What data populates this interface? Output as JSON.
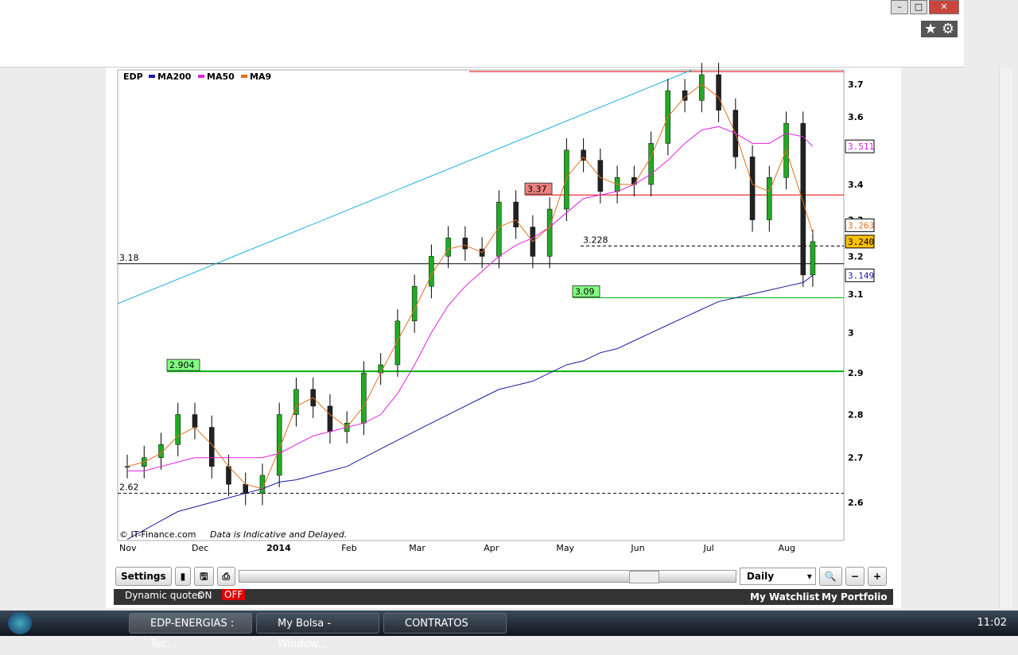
{
  "legend": {
    "symbol": "EDP",
    "items": [
      {
        "name": "MA200",
        "color": "#1a1aa0"
      },
      {
        "name": "MA50",
        "color": "#e020e0"
      },
      {
        "name": "MA9",
        "color": "#e07020"
      }
    ]
  },
  "copyright": "© IT-Finance.com",
  "disclaimer": "Data is Indicative and Delayed.",
  "chart_data": {
    "type": "candlestick",
    "yscale": "log",
    "ylim": [
      2.52,
      3.74
    ],
    "y_ticks": [
      3.7,
      3.6,
      3.4,
      3.3,
      3.2,
      3.1,
      3,
      2.9,
      2.8,
      2.7,
      2.6
    ],
    "x_ticks": [
      {
        "label": "Nov",
        "date": "2013-11-01"
      },
      {
        "label": "Dec",
        "date": "2013-12-01"
      },
      {
        "label": "2014",
        "date": "2014-01-01"
      },
      {
        "label": "Feb",
        "date": "2014-02-01"
      },
      {
        "label": "Mar",
        "date": "2014-03-01"
      },
      {
        "label": "Apr",
        "date": "2014-04-01"
      },
      {
        "label": "May",
        "date": "2014-05-01"
      },
      {
        "label": "Jun",
        "date": "2014-06-01"
      },
      {
        "label": "Jul",
        "date": "2014-07-01"
      },
      {
        "label": "Aug",
        "date": "2014-08-01"
      }
    ],
    "dates": [
      "2013-11-01",
      "2013-11-08",
      "2013-11-15",
      "2013-11-22",
      "2013-11-29",
      "2013-12-06",
      "2013-12-13",
      "2013-12-20",
      "2013-12-27",
      "2014-01-03",
      "2014-01-10",
      "2014-01-17",
      "2014-01-24",
      "2014-01-31",
      "2014-02-07",
      "2014-02-14",
      "2014-02-21",
      "2014-02-28",
      "2014-03-07",
      "2014-03-14",
      "2014-03-21",
      "2014-03-28",
      "2014-04-04",
      "2014-04-11",
      "2014-04-18",
      "2014-04-25",
      "2014-05-02",
      "2014-05-09",
      "2014-05-16",
      "2014-05-23",
      "2014-05-30",
      "2014-06-06",
      "2014-06-13",
      "2014-06-20",
      "2014-06-27",
      "2014-07-04",
      "2014-07-11",
      "2014-07-18",
      "2014-07-25",
      "2014-08-01",
      "2014-08-08",
      "2014-08-12"
    ],
    "close": [
      2.68,
      2.7,
      2.73,
      2.8,
      2.77,
      2.68,
      2.64,
      2.62,
      2.66,
      2.8,
      2.86,
      2.82,
      2.76,
      2.78,
      2.9,
      2.92,
      3.03,
      3.12,
      3.2,
      3.25,
      3.22,
      3.2,
      3.35,
      3.28,
      3.2,
      3.33,
      3.5,
      3.47,
      3.38,
      3.42,
      3.4,
      3.52,
      3.68,
      3.65,
      3.73,
      3.62,
      3.48,
      3.3,
      3.42,
      3.58,
      3.15,
      3.24
    ],
    "ma200": [
      2.52,
      2.54,
      2.56,
      2.58,
      2.59,
      2.6,
      2.61,
      2.62,
      2.63,
      2.645,
      2.65,
      2.66,
      2.67,
      2.68,
      2.7,
      2.72,
      2.74,
      2.76,
      2.78,
      2.8,
      2.82,
      2.84,
      2.86,
      2.87,
      2.88,
      2.9,
      2.92,
      2.93,
      2.95,
      2.96,
      2.98,
      3.0,
      3.02,
      3.04,
      3.06,
      3.08,
      3.09,
      3.1,
      3.11,
      3.12,
      3.13,
      3.149
    ],
    "ma50": [
      2.67,
      2.67,
      2.68,
      2.69,
      2.7,
      2.7,
      2.7,
      2.7,
      2.7,
      2.71,
      2.73,
      2.75,
      2.76,
      2.77,
      2.78,
      2.8,
      2.85,
      2.92,
      3.0,
      3.07,
      3.12,
      3.16,
      3.2,
      3.23,
      3.25,
      3.28,
      3.32,
      3.36,
      3.37,
      3.38,
      3.4,
      3.43,
      3.47,
      3.52,
      3.56,
      3.57,
      3.55,
      3.52,
      3.52,
      3.55,
      3.54,
      3.511
    ],
    "ma9": [
      2.68,
      2.69,
      2.71,
      2.75,
      2.77,
      2.73,
      2.68,
      2.64,
      2.63,
      2.72,
      2.82,
      2.84,
      2.8,
      2.77,
      2.82,
      2.9,
      2.98,
      3.06,
      3.15,
      3.22,
      3.23,
      3.21,
      3.28,
      3.3,
      3.24,
      3.28,
      3.42,
      3.48,
      3.42,
      3.4,
      3.4,
      3.48,
      3.6,
      3.66,
      3.7,
      3.66,
      3.55,
      3.4,
      3.38,
      3.5,
      3.35,
      3.263
    ],
    "levels": [
      {
        "value": 3.74,
        "color": "#e00000",
        "label": ""
      },
      {
        "value": 3.37,
        "color": "#e00000",
        "label": "3.37"
      },
      {
        "value": 3.228,
        "color": "#000000",
        "dashed": true,
        "label": "3.228"
      },
      {
        "value": 3.18,
        "color": "#000000",
        "label": "3.18"
      },
      {
        "value": 3.09,
        "color": "#00b000",
        "label": "3.09"
      },
      {
        "value": 2.904,
        "color": "#00b000",
        "label": "2.904"
      },
      {
        "value": 2.62,
        "color": "#000000",
        "dashed": true,
        "label": "2.62"
      }
    ],
    "value_tags": {
      "ma50": "3.511",
      "ma9": "3.263",
      "last": "3.240",
      "ma200": "3.149"
    }
  },
  "toolbar": {
    "settings": "Settings",
    "interval": "Daily"
  },
  "status": {
    "dynamic": "Dynamic quotes",
    "on": "ON",
    "off": "OFF",
    "watchlist": "My Watchlist",
    "portfolio": "My Portfolio"
  },
  "taskbar": {
    "tasks": [
      "EDP-ENERGIAS : Tec...",
      "My Bolsa - Window...",
      "CONTRATOS"
    ],
    "clock": "11:02"
  }
}
